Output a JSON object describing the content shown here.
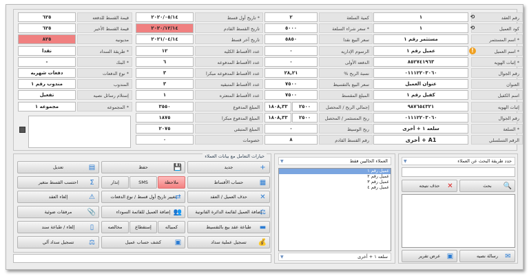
{
  "form": {
    "col_a": [
      {
        "label": "رقم العقد",
        "value": "١",
        "icon": "refresh-icon"
      },
      {
        "label": "كود العميل",
        "value": "١",
        "icon": "refresh-icon"
      },
      {
        "label": "* اسم المستثمر",
        "value": "مستثمر رقم ١"
      },
      {
        "label": "* اسم العميل",
        "value": "عميل رقم ١",
        "icon": "warning-icon"
      },
      {
        "label": "* إثبات الهويه",
        "value": "٨٥٢٧٤١٩٦٣"
      },
      {
        "label": "رقم الجوال",
        "value": "٠١١١٢٢٠٣٠٦٠"
      },
      {
        "label": "العنوان",
        "value": "عنوان العميل"
      },
      {
        "label": "اسم الكفيل",
        "value": "كفيل رقم ١"
      },
      {
        "label": "إثبات الهويه",
        "value": "٩٨٧٦٥٤٣٢١"
      },
      {
        "label": "رقم الجوال",
        "value": "٠١١١٢٢٠٣٠٦٠"
      },
      {
        "label": "* السلعة",
        "value": "سلعه ١ + أخرى"
      },
      {
        "label": "الرقم التسلسلي",
        "value": "A1 + أخرى"
      }
    ],
    "col_b": [
      {
        "label": "كمية السلعة",
        "value": "٢"
      },
      {
        "label": "* سعر شراء السلعة",
        "value": "٥٠٠٠"
      },
      {
        "label": "سعر البيع نقدا",
        "value": "٥٨٥٠"
      },
      {
        "label": "الرسوم الإداريه",
        "value": "٠"
      },
      {
        "label": "الدفعه الأولى",
        "value": "٠"
      },
      {
        "label": "نسبة الربح %",
        "value": "٢٨,٢١"
      },
      {
        "label": "سعر البيع بالتقسيط",
        "value": "٧٥٠٠"
      },
      {
        "label": "المبلغ المقسط",
        "value": "٧٥٠٠"
      },
      {
        "label": "إجمالي الربح / المحصل",
        "value": "٢٥٠٠",
        "value2": "١٨٠٨,٣٣"
      },
      {
        "label": "ربح المستثمر / المحصل",
        "value": "٢٥٠٠",
        "value2": "١٨٠٨,٣٣"
      },
      {
        "label": "ربح الوسيط",
        "value": "٠"
      },
      {
        "label": "رقم القسط القادم",
        "value": "٨"
      }
    ],
    "col_c": [
      {
        "label": "* تاريخ أول قسط",
        "value": "٢٠٢٠/٠٥/١٤"
      },
      {
        "label": "تاريخ القسط القادم",
        "value": "٢٠٢٠/١٢/١٤",
        "highlight": true
      },
      {
        "label": "تاريخ آخر قسط",
        "value": "٢٠٢١/٠٤/١٤"
      },
      {
        "label": "عدد الأقساط الكليه",
        "value": "١٢"
      },
      {
        "label": "عدد الأقساط المدفوعه",
        "value": "٦"
      },
      {
        "label": "عدد الأقساط المدفوعه مبكرا",
        "value": "٣"
      },
      {
        "label": "عدد الأقساط المتبقيه",
        "value": "٣"
      },
      {
        "label": "عدد الأقساط المتعثره",
        "value": "١"
      },
      {
        "label": "المبلغ المدفوع",
        "value": "٣٥٥٠"
      },
      {
        "label": "المبلغ المدفوع مبكرا",
        "value": "١٨٧٥"
      },
      {
        "label": "المبلغ المتبقي",
        "value": "٢٠٧٥"
      },
      {
        "label": "خصومات",
        "value": "٠"
      }
    ],
    "col_d": [
      {
        "label": "قيمة القسط للدفعه",
        "value": "٦٢٥"
      },
      {
        "label": "قيمة القسط الأخير",
        "value": "٦٢٥"
      },
      {
        "label": "مديونيه",
        "value": "٨٢٥",
        "highlight": true
      },
      {
        "label": "* طريقة السداد",
        "value": "نقدا"
      },
      {
        "label": "* البنك",
        "value": "-"
      },
      {
        "label": "* نوع الدفعات",
        "value": "دفعات شهريه"
      },
      {
        "label": "المندوب",
        "value": "مندوب رقم ١"
      },
      {
        "label": "إستلام رسائل نصيه",
        "value": "تفعيل"
      },
      {
        "label": "* المجموعه",
        "value": "مجموعه ١"
      }
    ],
    "notes": ""
  },
  "actions": {
    "title": "خيارات التعامل مع بيانات العملاء",
    "right": [
      {
        "label": "جديد",
        "icon": "plus-icon"
      },
      {
        "label": "حساب الأقساط",
        "icon": "calculator-icon"
      },
      {
        "label": "حذف العميل / العقد",
        "icon": "delete-icon"
      },
      {
        "label": "إضافة العميل لقائمة الدائرة القانونية",
        "icon": "legal-icon"
      },
      {
        "label": "طباعة عقد بيع بالتقسيط",
        "icon": "print-icon"
      },
      {
        "label": "تسجيل عملية سداد",
        "icon": "money-bag-icon"
      }
    ],
    "middle": {
      "save": "حفظ",
      "note": "ملاحظة",
      "sms": "SMS",
      "warning": "إنذار",
      "change_date": "تغيير تاريخ أول قسط / نوع الدفعات",
      "blacklist": "إضافة العميل للقائمة السوداء",
      "bill": "كمبياله",
      "deduction": "إستقطاع",
      "clearance": "مخالصه",
      "statement": "كشف حساب عميل"
    },
    "left": [
      {
        "label": "تعديل",
        "icon": "save-icon"
      },
      {
        "label": "احتسب القسط متغير",
        "icon": "calc-variable-icon"
      },
      {
        "label": "إلغاء العقد",
        "icon": "warning-triangle-icon"
      },
      {
        "label": "مرفقات ضوئية",
        "icon": "paperclip-icon"
      },
      {
        "label": "إلغاء / طباعة سند",
        "icon": "receipt-icon"
      },
      {
        "label": "تسجيل سداد آلي",
        "icon": "auto-pay-icon"
      }
    ]
  },
  "clients": {
    "filter": "العملاء الحاليين فقط",
    "items": [
      "عميل رقم ١",
      "عميل رقم ٢",
      "عميل رقم ٣",
      "عميل رقم ٤"
    ],
    "selected_index": 0,
    "product": "سلعه ١ + أخرى"
  },
  "search": {
    "method": "حدد طريقة البحث عن العملاء",
    "query": "",
    "search_label": "بحث",
    "clear_label": "حذف نتيجه",
    "sms_label": "رسالة نصيه",
    "report_label": "عرض تقرير"
  },
  "colors": {
    "highlight": "#f08080",
    "accent": "#2b7cd3"
  }
}
